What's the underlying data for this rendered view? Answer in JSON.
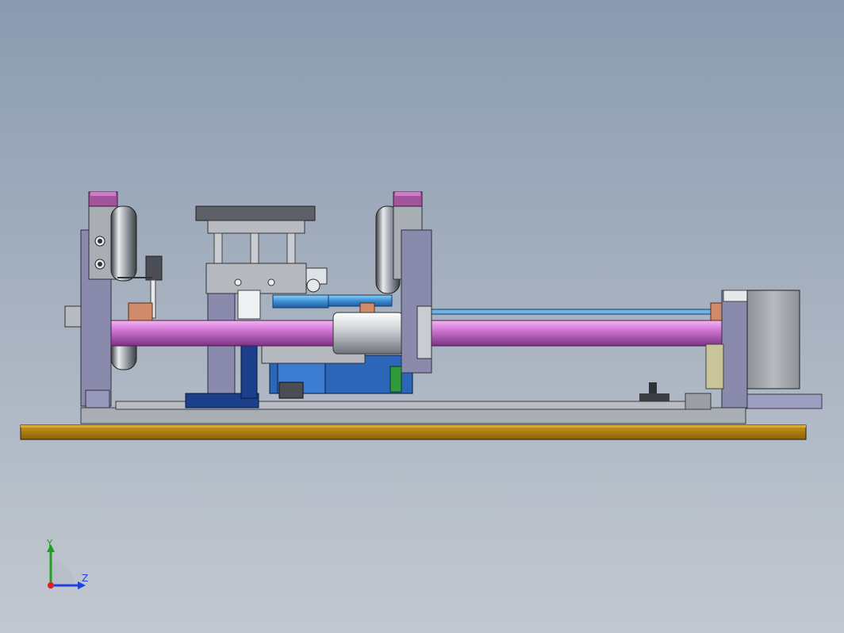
{
  "viewport": {
    "background_top": "#8b9bb0",
    "background_bottom": "#c2c8d0"
  },
  "model": {
    "colors": {
      "base_plate": "#b07f12",
      "frame_purple": "#8a8aac",
      "purple_cap": "#a0559a",
      "shaft_magenta": "#d47ad8",
      "blue_rail": "#3c8fd6",
      "dark_blue": "#1b3f8a",
      "gray_part": "#a9adb4",
      "dark_part": "#4b4f55",
      "bronze": "#d08b6b",
      "green": "#2e9b3c",
      "khaki": "#c9c59a"
    }
  },
  "triad": {
    "y_label": "Y",
    "z_label": "Z",
    "y_color": "#20a020",
    "z_color": "#2040e0",
    "x_color": "#e02020"
  }
}
